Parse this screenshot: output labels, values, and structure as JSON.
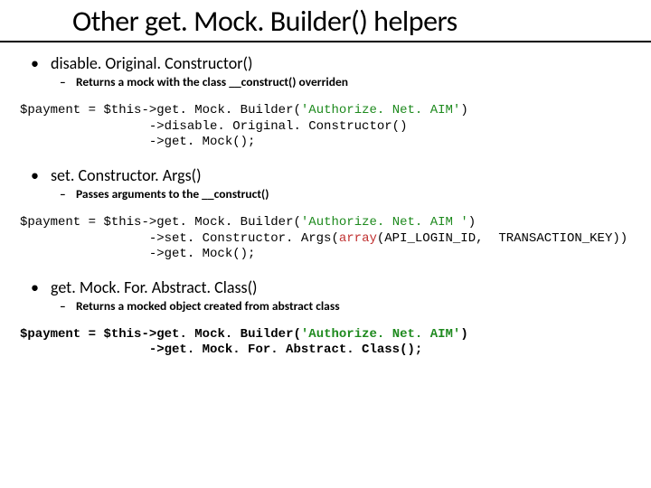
{
  "title": "Other get. Mock. Builder() helpers",
  "sections": [
    {
      "heading": "disable. Original. Constructor()",
      "sub": "Returns a mock with the class __construct() overriden",
      "code": {
        "bold": false,
        "lines": [
          [
            {
              "cls": "c-var",
              "t": "$payment"
            },
            {
              "cls": "c-op",
              "t": " = "
            },
            {
              "cls": "c-var",
              "t": "$this"
            },
            {
              "cls": "c-op",
              "t": "->get. Mock. Builder("
            },
            {
              "cls": "c-str",
              "t": "'Authorize. Net. AIM'"
            },
            {
              "cls": "c-op",
              "t": ")"
            }
          ],
          [
            {
              "cls": "c-op",
              "t": "                 ->disable. Original. Constructor()"
            }
          ],
          [
            {
              "cls": "c-op",
              "t": "                 ->get. Mock();"
            }
          ]
        ]
      }
    },
    {
      "heading": "set. Constructor. Args()",
      "sub": "Passes arguments to the __construct()",
      "code": {
        "bold": false,
        "lines": [
          [
            {
              "cls": "c-var",
              "t": "$payment"
            },
            {
              "cls": "c-op",
              "t": " = "
            },
            {
              "cls": "c-var",
              "t": "$this"
            },
            {
              "cls": "c-op",
              "t": "->get. Mock. Builder("
            },
            {
              "cls": "c-str",
              "t": "'Authorize. Net. AIM '"
            },
            {
              "cls": "c-op",
              "t": ")"
            }
          ],
          [
            {
              "cls": "c-op",
              "t": "                 ->set. Constructor. Args("
            },
            {
              "cls": "c-arr",
              "t": "array"
            },
            {
              "cls": "c-op",
              "t": "("
            },
            {
              "cls": "c-id",
              "t": "API_LOGIN_ID"
            },
            {
              "cls": "c-op",
              "t": ",  "
            },
            {
              "cls": "c-id",
              "t": "TRANSACTION_KEY"
            },
            {
              "cls": "c-op",
              "t": "))"
            }
          ],
          [
            {
              "cls": "c-op",
              "t": "                 ->get. Mock();"
            }
          ]
        ]
      }
    },
    {
      "heading": "get. Mock. For. Abstract. Class()",
      "sub": "Returns a mocked object created from abstract class",
      "code": {
        "bold": true,
        "lines": [
          [
            {
              "cls": "c-var",
              "t": "$payment"
            },
            {
              "cls": "c-op",
              "t": " = "
            },
            {
              "cls": "c-var",
              "t": "$this"
            },
            {
              "cls": "c-op",
              "t": "->get. Mock. Builder("
            },
            {
              "cls": "c-str",
              "t": "'Authorize. Net. AIM'"
            },
            {
              "cls": "c-op",
              "t": ")"
            }
          ],
          [
            {
              "cls": "c-op",
              "t": "                 ->get. Mock. For. Abstract. Class();"
            }
          ]
        ]
      }
    }
  ]
}
